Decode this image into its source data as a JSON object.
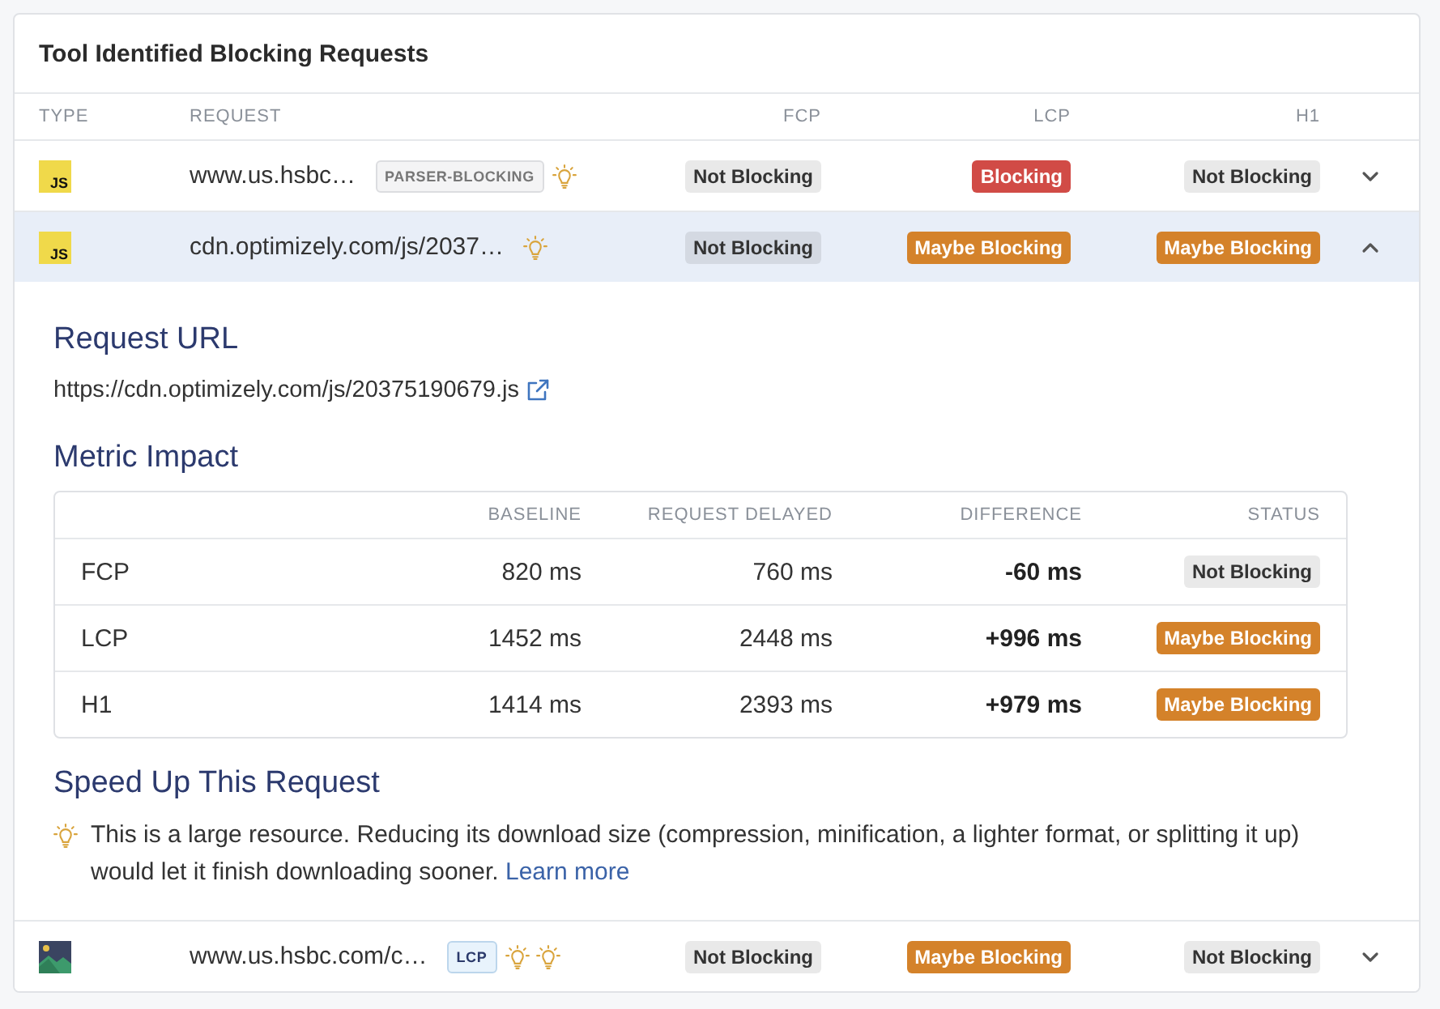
{
  "panel": {
    "title": "Tool Identified Blocking Requests"
  },
  "columns": [
    "TYPE",
    "REQUEST",
    "FCP",
    "LCP",
    "H1"
  ],
  "requests": [
    {
      "type": {
        "kind": "js",
        "label": "JS"
      },
      "request": "www.us.hsbc…",
      "tags": [
        {
          "text": "PARSER-BLOCKING",
          "kind": "plain"
        }
      ],
      "hints": [
        {
          "kind": "bulb"
        }
      ],
      "statuses": [
        {
          "text": "Not Blocking",
          "kind": "neutral"
        },
        {
          "text": "Blocking",
          "kind": "danger"
        },
        {
          "text": "Not Blocking",
          "kind": "neutral"
        }
      ],
      "expanded": false
    },
    {
      "type": {
        "kind": "js",
        "label": "JS"
      },
      "request": "cdn.optimizely.com/js/2037…",
      "hints": [
        {
          "kind": "bulb"
        }
      ],
      "statuses": [
        {
          "text": "Not Blocking",
          "kind": "neutral"
        },
        {
          "text": "Maybe Blocking",
          "kind": "warning"
        },
        {
          "text": "Maybe Blocking",
          "kind": "warning"
        }
      ],
      "expanded": true,
      "details": {
        "url_heading": "Request URL",
        "url": "https://cdn.optimizely.com/js/20375190679.js",
        "impact_heading": "Metric Impact",
        "impact_table": {
          "columns": [
            "BASELINE",
            "REQUEST DELAYED",
            "DIFFERENCE",
            "STATUS"
          ],
          "rows": [
            {
              "metric": "FCP",
              "baseline": "820 ms",
              "delayed": "760 ms",
              "difference": "-60 ms",
              "status": {
                "text": "Not Blocking",
                "kind": "neutral"
              }
            },
            {
              "metric": "LCP",
              "baseline": "1452 ms",
              "delayed": "2448 ms",
              "difference": "+996 ms",
              "status": {
                "text": "Maybe Blocking",
                "kind": "warning"
              }
            },
            {
              "metric": "H1",
              "baseline": "1414 ms",
              "delayed": "2393 ms",
              "difference": "+979 ms",
              "status": {
                "text": "Maybe Blocking",
                "kind": "warning"
              }
            }
          ]
        },
        "speed_heading": "Speed Up This Request",
        "tips": [
          {
            "kind": "bulb",
            "text": "This is a large resource. Reducing its download size (compression, minification, a lighter format, or splitting it up) would let it finish downloading sooner.",
            "link": "Learn more"
          }
        ]
      }
    },
    {
      "type": {
        "kind": "image"
      },
      "request": "www.us.hsbc.com/c…",
      "tags": [
        {
          "text": "LCP",
          "kind": "metric"
        }
      ],
      "hints": [
        {
          "kind": "bulb"
        },
        {
          "kind": "bulb"
        }
      ],
      "statuses": [
        {
          "text": "Not Blocking",
          "kind": "neutral"
        },
        {
          "text": "Maybe Blocking",
          "kind": "warning"
        },
        {
          "text": "Not Blocking",
          "kind": "neutral"
        }
      ],
      "expanded": false
    }
  ]
}
